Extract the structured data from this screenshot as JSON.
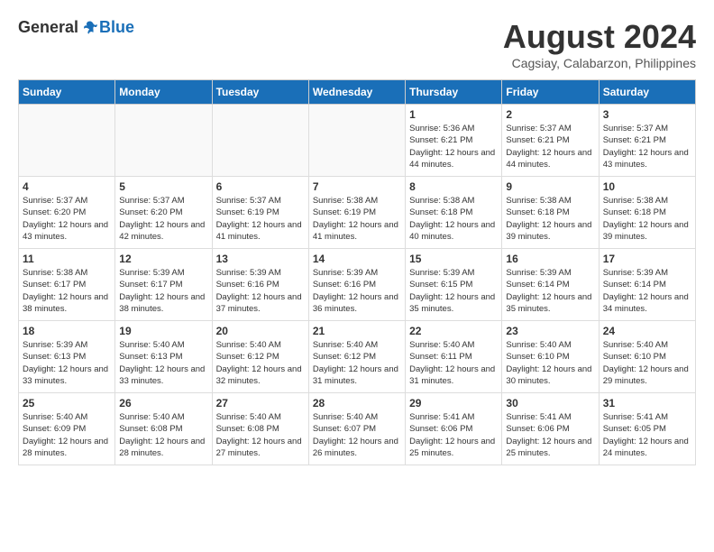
{
  "header": {
    "logo_general": "General",
    "logo_blue": "Blue",
    "month_year": "August 2024",
    "location": "Cagsiay, Calabarzon, Philippines"
  },
  "weekdays": [
    "Sunday",
    "Monday",
    "Tuesday",
    "Wednesday",
    "Thursday",
    "Friday",
    "Saturday"
  ],
  "weeks": [
    [
      {
        "day": "",
        "info": ""
      },
      {
        "day": "",
        "info": ""
      },
      {
        "day": "",
        "info": ""
      },
      {
        "day": "",
        "info": ""
      },
      {
        "day": "1",
        "info": "Sunrise: 5:36 AM\nSunset: 6:21 PM\nDaylight: 12 hours\nand 44 minutes."
      },
      {
        "day": "2",
        "info": "Sunrise: 5:37 AM\nSunset: 6:21 PM\nDaylight: 12 hours\nand 44 minutes."
      },
      {
        "day": "3",
        "info": "Sunrise: 5:37 AM\nSunset: 6:21 PM\nDaylight: 12 hours\nand 43 minutes."
      }
    ],
    [
      {
        "day": "4",
        "info": "Sunrise: 5:37 AM\nSunset: 6:20 PM\nDaylight: 12 hours\nand 43 minutes."
      },
      {
        "day": "5",
        "info": "Sunrise: 5:37 AM\nSunset: 6:20 PM\nDaylight: 12 hours\nand 42 minutes."
      },
      {
        "day": "6",
        "info": "Sunrise: 5:37 AM\nSunset: 6:19 PM\nDaylight: 12 hours\nand 41 minutes."
      },
      {
        "day": "7",
        "info": "Sunrise: 5:38 AM\nSunset: 6:19 PM\nDaylight: 12 hours\nand 41 minutes."
      },
      {
        "day": "8",
        "info": "Sunrise: 5:38 AM\nSunset: 6:18 PM\nDaylight: 12 hours\nand 40 minutes."
      },
      {
        "day": "9",
        "info": "Sunrise: 5:38 AM\nSunset: 6:18 PM\nDaylight: 12 hours\nand 39 minutes."
      },
      {
        "day": "10",
        "info": "Sunrise: 5:38 AM\nSunset: 6:18 PM\nDaylight: 12 hours\nand 39 minutes."
      }
    ],
    [
      {
        "day": "11",
        "info": "Sunrise: 5:38 AM\nSunset: 6:17 PM\nDaylight: 12 hours\nand 38 minutes."
      },
      {
        "day": "12",
        "info": "Sunrise: 5:39 AM\nSunset: 6:17 PM\nDaylight: 12 hours\nand 38 minutes."
      },
      {
        "day": "13",
        "info": "Sunrise: 5:39 AM\nSunset: 6:16 PM\nDaylight: 12 hours\nand 37 minutes."
      },
      {
        "day": "14",
        "info": "Sunrise: 5:39 AM\nSunset: 6:16 PM\nDaylight: 12 hours\nand 36 minutes."
      },
      {
        "day": "15",
        "info": "Sunrise: 5:39 AM\nSunset: 6:15 PM\nDaylight: 12 hours\nand 35 minutes."
      },
      {
        "day": "16",
        "info": "Sunrise: 5:39 AM\nSunset: 6:14 PM\nDaylight: 12 hours\nand 35 minutes."
      },
      {
        "day": "17",
        "info": "Sunrise: 5:39 AM\nSunset: 6:14 PM\nDaylight: 12 hours\nand 34 minutes."
      }
    ],
    [
      {
        "day": "18",
        "info": "Sunrise: 5:39 AM\nSunset: 6:13 PM\nDaylight: 12 hours\nand 33 minutes."
      },
      {
        "day": "19",
        "info": "Sunrise: 5:40 AM\nSunset: 6:13 PM\nDaylight: 12 hours\nand 33 minutes."
      },
      {
        "day": "20",
        "info": "Sunrise: 5:40 AM\nSunset: 6:12 PM\nDaylight: 12 hours\nand 32 minutes."
      },
      {
        "day": "21",
        "info": "Sunrise: 5:40 AM\nSunset: 6:12 PM\nDaylight: 12 hours\nand 31 minutes."
      },
      {
        "day": "22",
        "info": "Sunrise: 5:40 AM\nSunset: 6:11 PM\nDaylight: 12 hours\nand 31 minutes."
      },
      {
        "day": "23",
        "info": "Sunrise: 5:40 AM\nSunset: 6:10 PM\nDaylight: 12 hours\nand 30 minutes."
      },
      {
        "day": "24",
        "info": "Sunrise: 5:40 AM\nSunset: 6:10 PM\nDaylight: 12 hours\nand 29 minutes."
      }
    ],
    [
      {
        "day": "25",
        "info": "Sunrise: 5:40 AM\nSunset: 6:09 PM\nDaylight: 12 hours\nand 28 minutes."
      },
      {
        "day": "26",
        "info": "Sunrise: 5:40 AM\nSunset: 6:08 PM\nDaylight: 12 hours\nand 28 minutes."
      },
      {
        "day": "27",
        "info": "Sunrise: 5:40 AM\nSunset: 6:08 PM\nDaylight: 12 hours\nand 27 minutes."
      },
      {
        "day": "28",
        "info": "Sunrise: 5:40 AM\nSunset: 6:07 PM\nDaylight: 12 hours\nand 26 minutes."
      },
      {
        "day": "29",
        "info": "Sunrise: 5:41 AM\nSunset: 6:06 PM\nDaylight: 12 hours\nand 25 minutes."
      },
      {
        "day": "30",
        "info": "Sunrise: 5:41 AM\nSunset: 6:06 PM\nDaylight: 12 hours\nand 25 minutes."
      },
      {
        "day": "31",
        "info": "Sunrise: 5:41 AM\nSunset: 6:05 PM\nDaylight: 12 hours\nand 24 minutes."
      }
    ]
  ]
}
